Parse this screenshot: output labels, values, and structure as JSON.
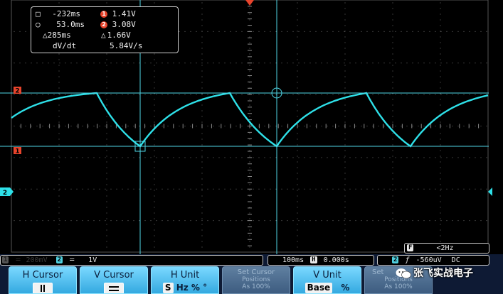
{
  "readout": {
    "h_cursor_1": "-232ms",
    "h_cursor_2": "53.0ms",
    "h_delta": "285ms",
    "v_badge_1": "1",
    "v_cursor_1": "1.41V",
    "v_badge_2": "2",
    "v_cursor_2": "3.08V",
    "v_delta": "1.66V",
    "slope_label": "dV/dt",
    "slope_value": "5.84V/s"
  },
  "markers": {
    "ref_2": "2",
    "ref_1": "1",
    "ch_2": "2"
  },
  "status": {
    "ch1_scale": "200mV",
    "ch2_badge": "2",
    "ch2_scale": "1V",
    "timebase": "100ms",
    "h_badge": "H",
    "h_position": "0.000s",
    "trig_badge": "2",
    "trig_level": "-560uV",
    "coupling": "DC",
    "freq_badge": "F",
    "frequency": "<2Hz"
  },
  "menu": {
    "h_cursor": "H Cursor",
    "v_cursor": "V Cursor",
    "h_unit": "H Unit",
    "h_unit_s": "S",
    "h_unit_hz": "Hz",
    "h_unit_pct": "%",
    "h_unit_deg": "°",
    "set_cursor_title": "Set Cursor",
    "set_cursor_sub1": "Positions",
    "set_cursor_sub2": "As 100%",
    "v_unit": "V Unit",
    "v_unit_base": "Base",
    "v_unit_pct": "%",
    "right_title": "Set",
    "right_sub1": "Positions",
    "right_sub2": "As 100%"
  },
  "watermark": "张飞实战电子",
  "colors": {
    "trace": "#2ee0e8",
    "cursor": "#4fd6e6",
    "accent": "#e8442c",
    "grid": "#505050"
  }
}
